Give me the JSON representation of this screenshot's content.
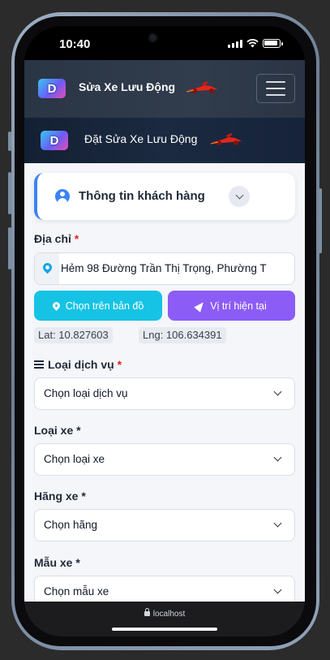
{
  "status_bar": {
    "time": "10:40"
  },
  "header": {
    "brand": "Sửa Xe Lưu Động",
    "logo_letter": "D"
  },
  "banner": {
    "title": "Đặt Sửa Xe Lưu Động",
    "logo_letter": "D"
  },
  "customer_section": {
    "title": "Thông tin khách hàng"
  },
  "address": {
    "label": "Địa chỉ",
    "required_mark": "*",
    "value": "Hẻm 98 Đường Trần Thị Trọng, Phường T"
  },
  "buttons": {
    "choose_on_map": "Chọn trên bản đồ",
    "current_location": "Vị trí hiện tại"
  },
  "coordinates": {
    "lat_text": "Lat: 10.827603",
    "lng_text": "Lng: 106.634391"
  },
  "service_type": {
    "label": "Loại dịch vụ",
    "required_mark": "*",
    "selected": "Chọn loại dịch vụ"
  },
  "vehicle_type": {
    "label": "Loại xe *",
    "selected": "Chọn loại xe"
  },
  "brand": {
    "label": "Hãng xe *",
    "selected": "Chọn hãng"
  },
  "model": {
    "label": "Mẫu xe *",
    "selected": "Chọn mẫu xe"
  },
  "browser": {
    "url": "localhost"
  },
  "colors": {
    "accent_blue": "#3b82f6",
    "map_button": "#16c3e4",
    "location_button": "#8b5cf6",
    "required": "#dc2626"
  }
}
